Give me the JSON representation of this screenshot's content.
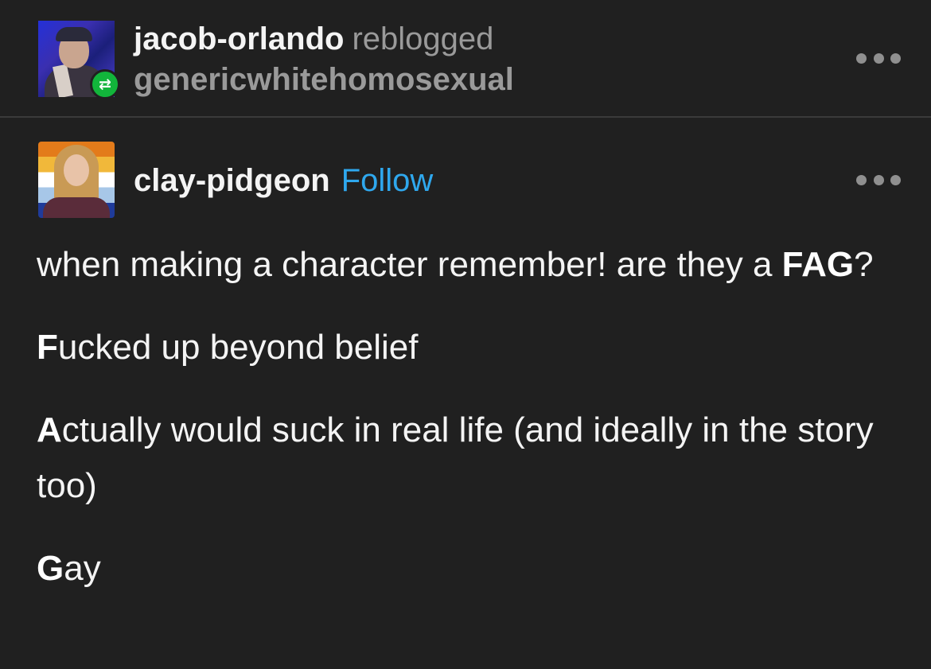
{
  "header": {
    "reblogger": "jacob-orlando",
    "action": "reblogged",
    "source": "genericwhitehomosexual",
    "reblog_icon": "⇄"
  },
  "post": {
    "author": "clay-pidgeon",
    "follow_label": "Follow",
    "paragraphs": [
      {
        "before": "when making a character remember! are they a ",
        "bold": "FAG",
        "after": "?"
      },
      {
        "bold": "F",
        "after": "ucked up beyond belief"
      },
      {
        "bold": "A",
        "after": "ctually would suck in real life (and ideally in the story too)"
      },
      {
        "bold": "G",
        "after": "ay"
      }
    ]
  },
  "icons": {
    "more": "more-options-icon",
    "reblog": "reblog-icon"
  },
  "colors": {
    "background": "#202020",
    "follow": "#2fa8ee",
    "reblog_badge": "#12b53b",
    "muted_text": "#9a9a9a"
  }
}
